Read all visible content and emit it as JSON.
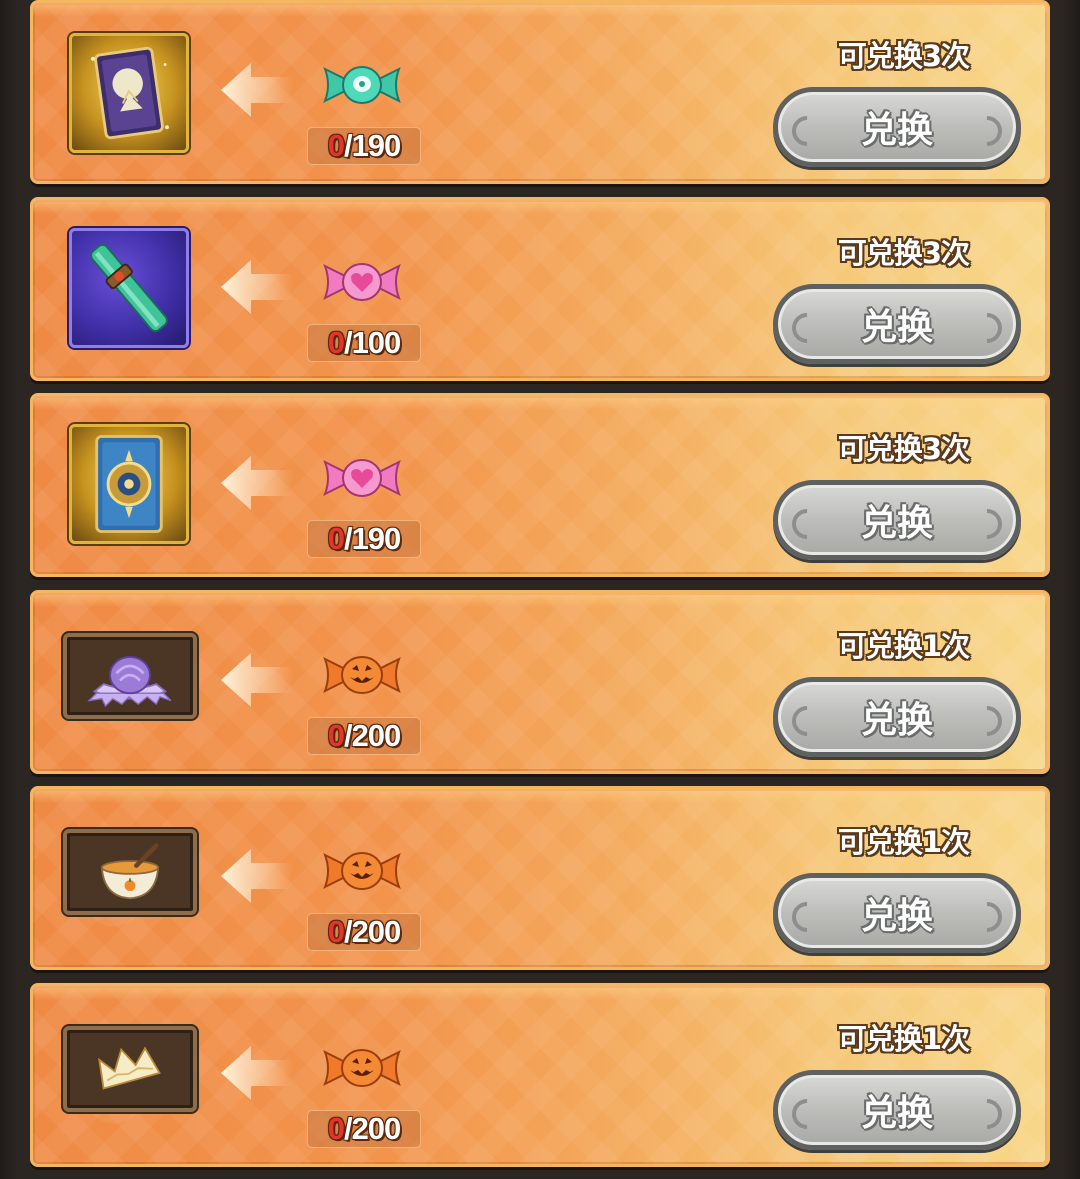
{
  "exchange_list": [
    {
      "reward_icon": "tarot-card-icon",
      "reward_style": "gold",
      "candy_icon": "teal-candy-icon",
      "candy_color": "#3fc7a8",
      "have": "0",
      "need": "/190",
      "limit": "可兑换3次",
      "button": "兑换"
    },
    {
      "reward_icon": "jade-wand-icon",
      "reward_style": "purple",
      "candy_icon": "pink-heart-candy-icon",
      "candy_color": "#f07bc0",
      "have": "0",
      "need": "/100",
      "limit": "可兑换3次",
      "button": "兑换"
    },
    {
      "reward_icon": "card-back-icon",
      "reward_style": "gold",
      "candy_icon": "pink-heart-candy-icon",
      "candy_color": "#f07bc0",
      "have": "0",
      "need": "/190",
      "limit": "可兑换3次",
      "button": "兑换"
    },
    {
      "reward_icon": "purple-flower-hat-icon",
      "reward_style": "brown",
      "candy_icon": "pumpkin-candy-icon",
      "candy_color": "#f07a2a",
      "have": "0",
      "need": "/200",
      "limit": "可兑换1次",
      "button": "兑换"
    },
    {
      "reward_icon": "pumpkin-soup-bowl-icon",
      "reward_style": "brown",
      "candy_icon": "pumpkin-candy-icon",
      "candy_color": "#f07a2a",
      "have": "0",
      "need": "/200",
      "limit": "可兑换1次",
      "button": "兑换"
    },
    {
      "reward_icon": "paper-crown-icon",
      "reward_style": "brown",
      "candy_icon": "pumpkin-candy-icon",
      "candy_color": "#f07a2a",
      "have": "0",
      "need": "/200",
      "limit": "可兑换1次",
      "button": "兑换"
    }
  ]
}
